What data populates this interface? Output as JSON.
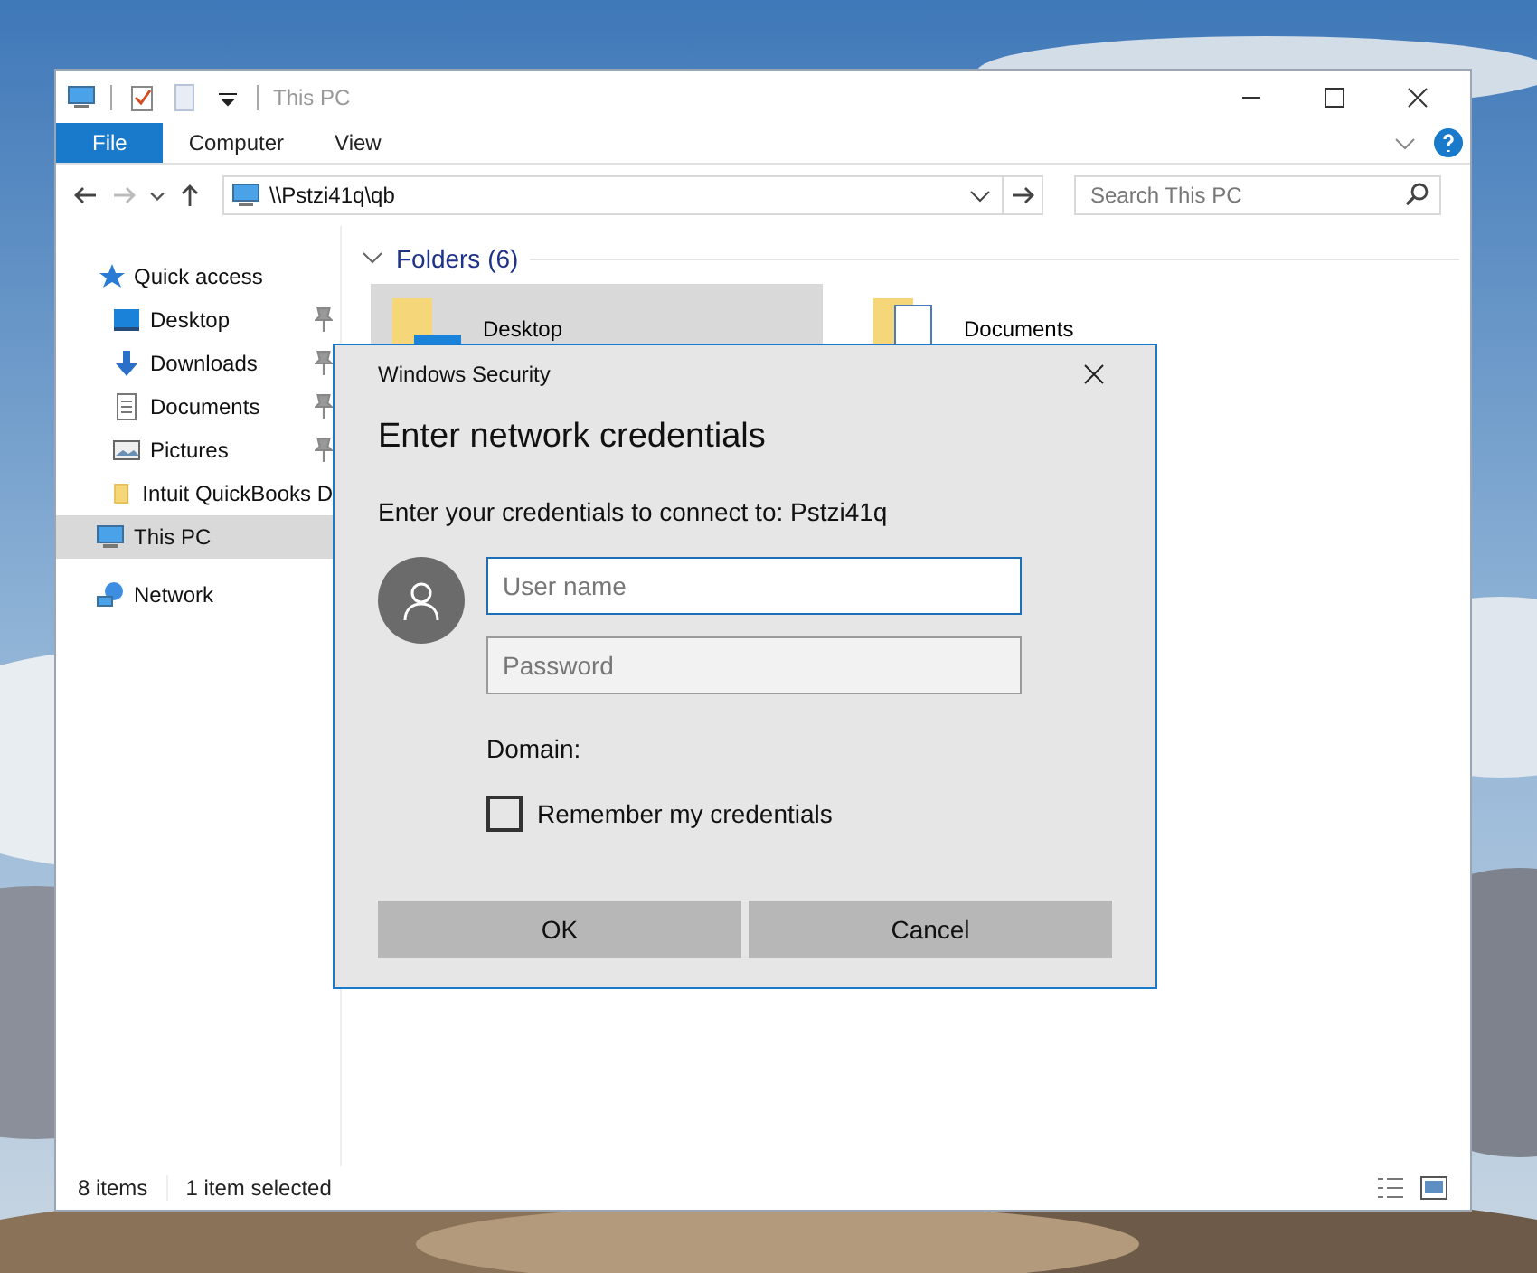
{
  "window": {
    "title": "This PC"
  },
  "ribbon_tabs": [
    {
      "label": "File",
      "selected": true
    },
    {
      "label": "Computer",
      "selected": false
    },
    {
      "label": "View",
      "selected": false
    }
  ],
  "address": {
    "path": "\\\\Pstzi41q\\qb"
  },
  "search": {
    "placeholder": "Search This PC"
  },
  "sidebar": {
    "items": [
      {
        "label": "Quick access",
        "kind": "star",
        "selected": false,
        "children": [
          {
            "label": "Desktop",
            "kind": "desktop",
            "pinned": true,
            "selected": false
          },
          {
            "label": "Downloads",
            "kind": "download",
            "pinned": true,
            "selected": false
          },
          {
            "label": "Documents",
            "kind": "document",
            "pinned": true,
            "selected": false
          },
          {
            "label": "Pictures",
            "kind": "picture",
            "pinned": true,
            "selected": false
          },
          {
            "label": "Intuit QuickBooks D",
            "kind": "folder",
            "pinned": false,
            "selected": false
          }
        ]
      },
      {
        "label": "This PC",
        "kind": "pc",
        "selected": true
      },
      {
        "label": "Network",
        "kind": "network",
        "selected": false
      }
    ]
  },
  "folders": {
    "header": "Folders (6)",
    "items": [
      {
        "name": "Desktop",
        "kind": "desktop",
        "selected": true
      },
      {
        "name": "Documents",
        "kind": "document",
        "selected": false
      }
    ]
  },
  "dialog": {
    "title": "Windows Security",
    "heading": "Enter network credentials",
    "message": "Enter your credentials to connect to: Pstzi41q",
    "username": {
      "placeholder": "User name"
    },
    "password": {
      "placeholder": "Password"
    },
    "domain_label": "Domain:",
    "remember": {
      "label": "Remember my credentials",
      "checked": false
    },
    "buttons": [
      "OK",
      "Cancel"
    ]
  },
  "status_bar": {
    "items": "8 items",
    "selection": "1 item selected"
  }
}
